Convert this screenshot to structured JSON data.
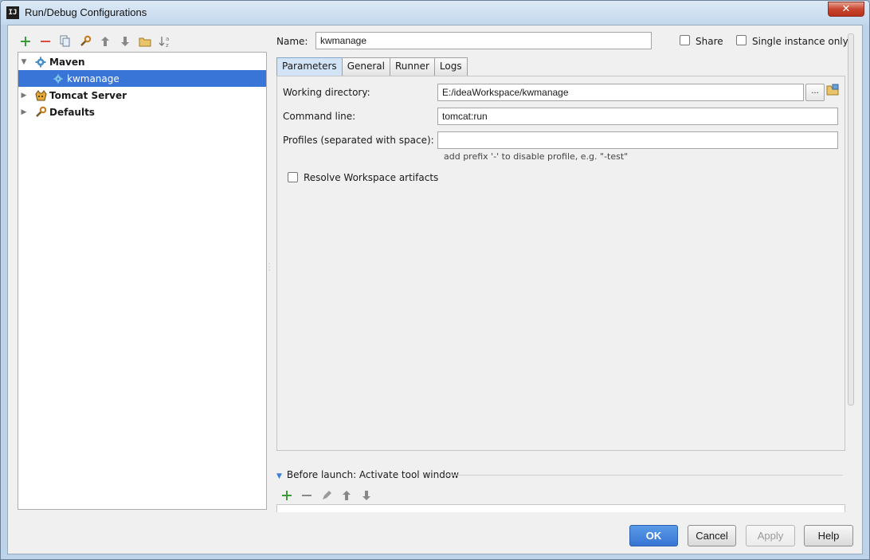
{
  "window": {
    "title": "Run/Debug Configurations",
    "close_label": "✕"
  },
  "toolbar": {
    "icons": [
      "add-icon",
      "remove-icon",
      "copy-icon",
      "edit-defaults-icon",
      "move-up-icon",
      "move-down-icon",
      "folder-icon",
      "sort-icon"
    ]
  },
  "tree": {
    "items": [
      {
        "label": "Maven",
        "level": 0,
        "expanded": true,
        "icon": "maven-gear-icon"
      },
      {
        "label": "kwmanage",
        "level": 1,
        "selected": true,
        "icon": "maven-gear-icon"
      },
      {
        "label": "Tomcat Server",
        "level": 0,
        "expanded": false,
        "icon": "tomcat-icon"
      },
      {
        "label": "Defaults",
        "level": 0,
        "expanded": false,
        "icon": "defaults-wrench-icon"
      }
    ]
  },
  "form": {
    "name_label": "Name:",
    "name_value": "kwmanage",
    "share_label": "Share",
    "single_instance_label": "Single instance only"
  },
  "tabs": [
    {
      "label": "Parameters",
      "active": true
    },
    {
      "label": "General"
    },
    {
      "label": "Runner"
    },
    {
      "label": "Logs"
    }
  ],
  "parameters": {
    "working_dir_label": "Working directory:",
    "working_dir_value": "E:/ideaWorkspace/kwmanage",
    "browse_label": "...",
    "command_line_label": "Command line:",
    "command_line_value": "tomcat:run",
    "profiles_label": "Profiles (separated with space):",
    "profiles_value": "",
    "profiles_hint": "add prefix '-' to disable profile, e.g. \"-test\"",
    "resolve_label": "Resolve Workspace artifacts"
  },
  "before_launch": {
    "title": "Before launch: Activate tool window"
  },
  "buttons": {
    "ok": "OK",
    "cancel": "Cancel",
    "apply": "Apply",
    "help": "Help"
  },
  "colors": {
    "selection": "#3875d6",
    "add_green": "#3b9b3b",
    "remove_red": "#d94a3f",
    "ok_blue": "#3874d4"
  }
}
